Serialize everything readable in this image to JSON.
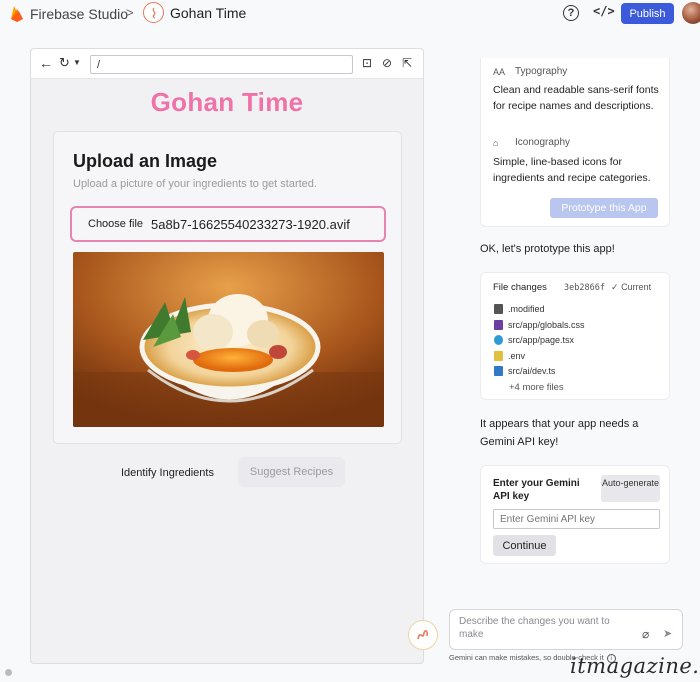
{
  "header": {
    "brand": "Firebase Studio",
    "breadcrumb_separator": ">",
    "project_name": "Gohan Time",
    "help_label": "?",
    "code_label": "</>",
    "publish_label": "Publish"
  },
  "preview": {
    "url": "/",
    "app_title": "Gohan Time",
    "upload_title": "Upload an Image",
    "upload_subtitle": "Upload a picture of your ingredients to get started.",
    "file_button": "Choose file",
    "file_name": "5a8b7-16625540233273-1920.avif",
    "identify_label": "Identify Ingredients",
    "suggest_label": "Suggest Recipes"
  },
  "chat": {
    "typography_label": "Typography",
    "typography_text": "Clean and readable sans-serif fonts for recipe names and descriptions.",
    "iconography_label": "Iconography",
    "iconography_text": "Simple, line-based icons for ingredients and recipe categories.",
    "prototype_button": "Prototype this App",
    "msg_prototype": "OK, let's prototype this app!",
    "file_changes": {
      "title": "File changes",
      "hash": "3eb2866f",
      "status": "Current",
      "files": [
        {
          "name": ".modified",
          "color": "#555555"
        },
        {
          "name": "src/app/globals.css",
          "color": "#6b3fa0"
        },
        {
          "name": "src/app/page.tsx",
          "color": "#2f9bd6"
        },
        {
          "name": ".env",
          "color": "#e0c040"
        },
        {
          "name": "src/ai/dev.ts",
          "color": "#3178c6"
        }
      ],
      "more": "+4 more files"
    },
    "msg_api_key": "It appears that your app needs a Gemini API key!",
    "api_key_label": "Enter your Gemini API key",
    "auto_generate": "Auto-generate",
    "api_key_placeholder": "Enter Gemini API key",
    "continue_label": "Continue",
    "prompt_placeholder": "Describe the changes you want to make",
    "disclaimer": "Gemini can make mistakes, so double-check it"
  },
  "watermark": "itmagazine.cc",
  "colors": {
    "accent": "#3b5bdb",
    "title_pink": "#ef73a8",
    "file_border": "#e684b2",
    "prototype_button": "#b9c6ef"
  }
}
